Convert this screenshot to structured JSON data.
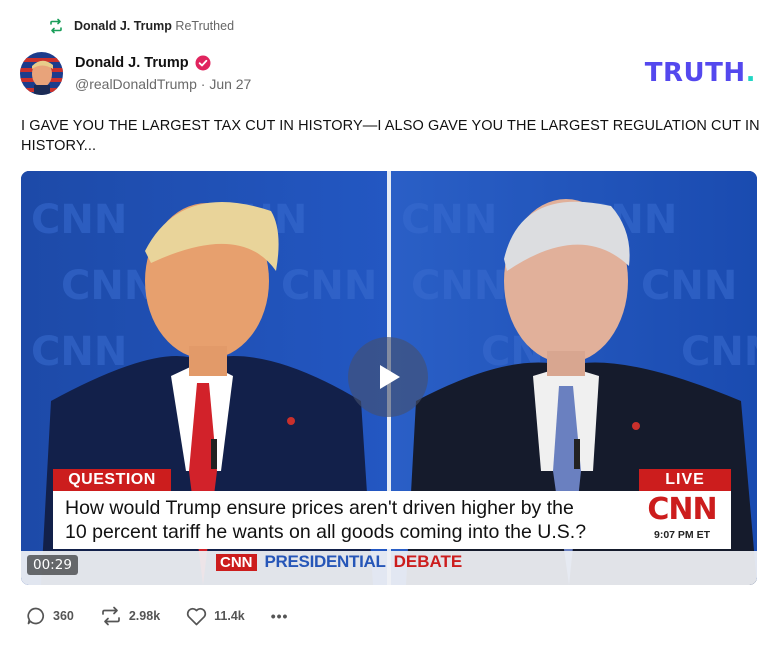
{
  "retruth": {
    "name": "Donald J. Trump",
    "label": "ReTruthed"
  },
  "author": {
    "display_name": "Donald J. Trump",
    "handle": "@realDonaldTrump",
    "separator": "·",
    "date": "Jun 27",
    "verified": true
  },
  "brand": {
    "text": "TRUTH",
    "dot": ".",
    "color": "#5448ee",
    "dot_color": "#21d6c4"
  },
  "post": {
    "text": "I GAVE YOU THE LARGEST TAX CUT IN HISTORY—I ALSO GAVE YOU THE LARGEST REGULATION CUT IN HISTORY..."
  },
  "video": {
    "timecode": "00:29",
    "chyron": {
      "tag": "QUESTION",
      "live": "LIVE",
      "line1": "How would Trump ensure prices aren't driven higher by the",
      "line2": "10 percent tariff he wants on all goods coming into the U.S.?",
      "network": "CNN",
      "time": "9:07 PM ET"
    },
    "bar": {
      "network": "CNN",
      "label": "PRESIDENTIAL",
      "sub": "DEBATE"
    }
  },
  "actions": {
    "replies": "360",
    "retruths": "2.98k",
    "likes": "11.4k",
    "more": "•••"
  },
  "colors": {
    "verified": "#e0245e",
    "cnn_red": "#cc1d1d",
    "backdrop_blue": "#173a8e"
  }
}
